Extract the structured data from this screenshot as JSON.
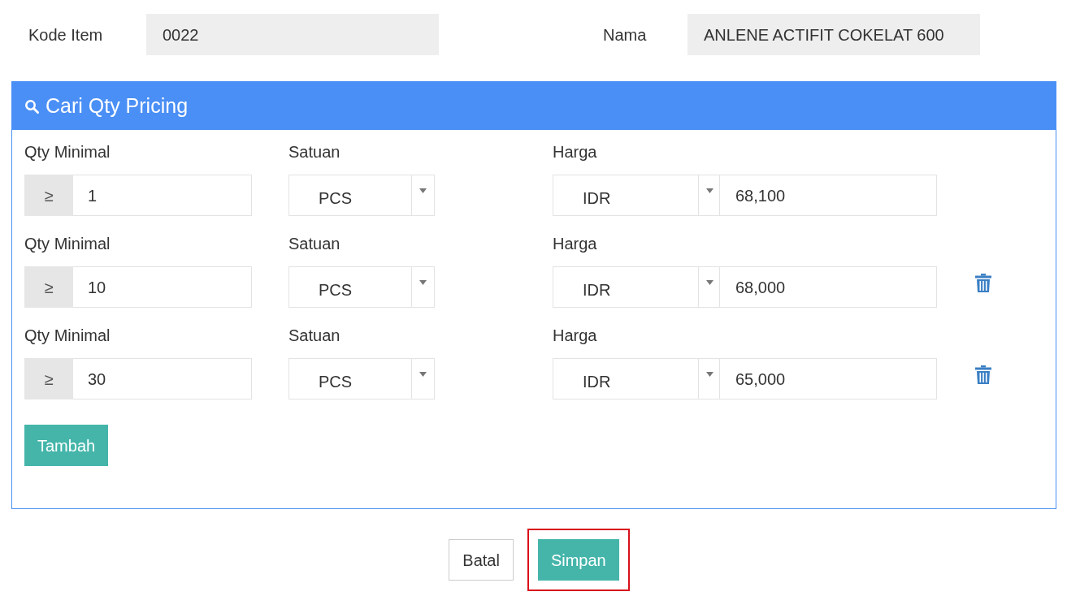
{
  "header_fields": [
    {
      "label": "Kode Item",
      "value": "0022"
    },
    {
      "label": "Nama",
      "value": "ANLENE ACTIFIT COKELAT 600"
    }
  ],
  "panel": {
    "title": "Cari Qty Pricing",
    "rows": [
      {
        "qty_label": "Qty Minimal",
        "qty_prefix": "≥",
        "qty": "1",
        "unit_label": "Satuan",
        "unit": "PCS",
        "price_label": "Harga",
        "currency": "IDR",
        "price": "68,100",
        "deletable": false
      },
      {
        "qty_label": "Qty Minimal",
        "qty_prefix": "≥",
        "qty": "10",
        "unit_label": "Satuan",
        "unit": "PCS",
        "price_label": "Harga",
        "currency": "IDR",
        "price": "68,000",
        "deletable": true
      },
      {
        "qty_label": "Qty Minimal",
        "qty_prefix": "≥",
        "qty": "30",
        "unit_label": "Satuan",
        "unit": "PCS",
        "price_label": "Harga",
        "currency": "IDR",
        "price": "65,000",
        "deletable": true
      }
    ],
    "add_button": "Tambah"
  },
  "actions": [
    {
      "label": "Batal",
      "kind": "secondary",
      "highlighted": false
    },
    {
      "label": "Simpan",
      "kind": "primary",
      "highlighted": true
    }
  ]
}
